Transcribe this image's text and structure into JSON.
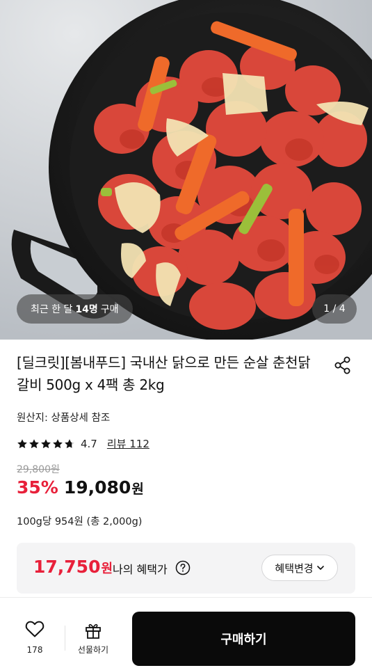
{
  "hero": {
    "image_alt": "",
    "buyers_prefix": "최근 한 달",
    "buyers_count": "14명",
    "buyers_suffix": "구매",
    "pager": "1 / 4"
  },
  "product": {
    "title": "[딜크릿][봄내푸드] 국내산 닭으로 만든 순살 춘천닭갈비 500g x 4팩 총 2kg",
    "origin": "원산지: 상품상세 참조",
    "rating": "4.7",
    "review_label": "리뷰 112",
    "original_price": "29,800원",
    "discount": "35%",
    "sale_price": "19,080",
    "won": "원",
    "unit_price": "100g당 954원 (총 2,000g)"
  },
  "benefit": {
    "amount": "17,750",
    "won": "원",
    "label": "나의 혜택가",
    "change_label": "혜택변경"
  },
  "bottom": {
    "like_count": "178",
    "gift_label": "선물하기",
    "buy_label": "구매하기"
  },
  "colors": {
    "accent_red": "#e8203a",
    "buy_button": "#0a0a0a"
  },
  "icons": [
    "share-icon",
    "star-icon",
    "help-icon",
    "chevron-down-icon",
    "heart-icon",
    "gift-icon"
  ]
}
